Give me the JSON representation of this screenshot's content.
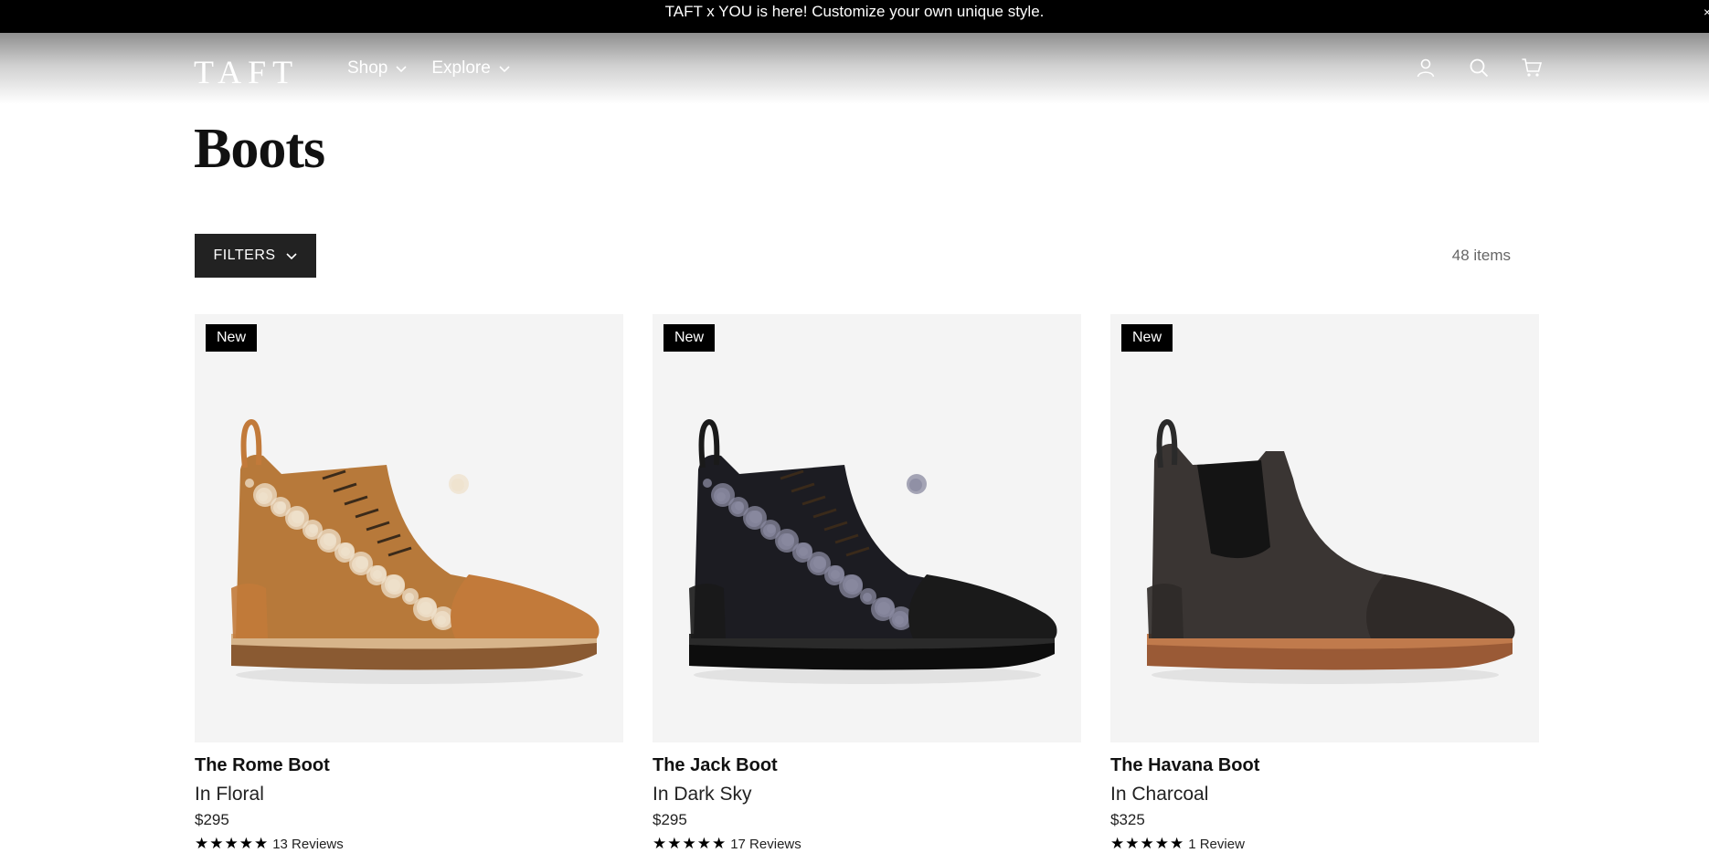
{
  "announcement": {
    "text": "TAFT x YOU is here! Customize your own unique style."
  },
  "header": {
    "logo": "TAFT",
    "nav": [
      {
        "label": "Shop"
      },
      {
        "label": "Explore"
      }
    ],
    "icons": [
      "account-icon",
      "search-icon",
      "cart-icon"
    ]
  },
  "page": {
    "title": "Boots",
    "filters_label": "FILTERS",
    "item_count": "48 items"
  },
  "products": [
    {
      "badge": "New",
      "name": "The Rome Boot",
      "color": "In Floral",
      "price": "$295",
      "rating_stars": 5,
      "reviews": "13 Reviews",
      "palette": {
        "upper": "#b7793a",
        "pattern": "#efe2cc",
        "cap": "#c27a3a",
        "sole": "#8a5a32",
        "welt": "#d7b48a"
      }
    },
    {
      "badge": "New",
      "name": "The Jack Boot",
      "color": "In Dark Sky",
      "price": "$295",
      "rating_stars": 5,
      "reviews": "17 Reviews",
      "palette": {
        "upper": "#1c1c22",
        "pattern": "#8a8aa0",
        "cap": "#1a1a1a",
        "sole": "#0d0d0d",
        "welt": "#2a2a2a"
      }
    },
    {
      "badge": "New",
      "name": "The Havana Boot",
      "color": "In Charcoal",
      "price": "$325",
      "rating_stars": 5,
      "reviews": "1 Review",
      "palette": {
        "upper": "#3a3533",
        "pattern": "#141414",
        "cap": "#2f2a28",
        "sole": "#9a5a36",
        "welt": "#c07a4c"
      }
    }
  ]
}
